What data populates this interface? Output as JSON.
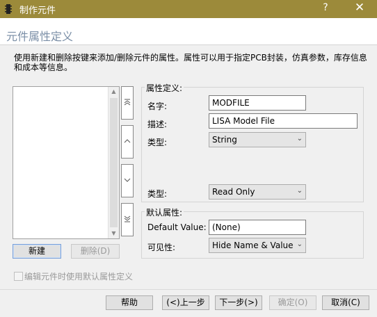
{
  "window": {
    "title": "制作元件",
    "help_glyph": "?",
    "close_glyph": "✕"
  },
  "header": {
    "heading": "元件属性定义"
  },
  "description": "使用新建和删除按键来添加/删除元件的属性。属性可以用于指定PCB封装，仿真参数，库存信息和成本等信息。",
  "list_buttons": {
    "new_label": "新建",
    "delete_label": "删除(D)"
  },
  "property_def": {
    "group_title": "属性定义:",
    "name_label": "名字:",
    "name_value": "MODFILE",
    "desc_label": "描述:",
    "desc_value": "LISA Model File",
    "type_label": "类型:",
    "type_value": "String",
    "type2_label": "类型:",
    "type2_value": "Read Only"
  },
  "default_props": {
    "group_title": "默认属性:",
    "default_value_label": "Default Value:",
    "default_value": "(None)",
    "visibility_label": "可见性:",
    "visibility_value": "Hide Name & Value"
  },
  "checkbox": {
    "label": "编辑元件时使用默认属性定义",
    "checked": false
  },
  "footer": {
    "help": "帮助",
    "back": "(<)上一步",
    "next": "下一步(>)",
    "ok": "确定(O)",
    "cancel": "取消(C)"
  },
  "colors": {
    "titlebar": "#9c8a3a",
    "heading": "#7a8ea6"
  }
}
